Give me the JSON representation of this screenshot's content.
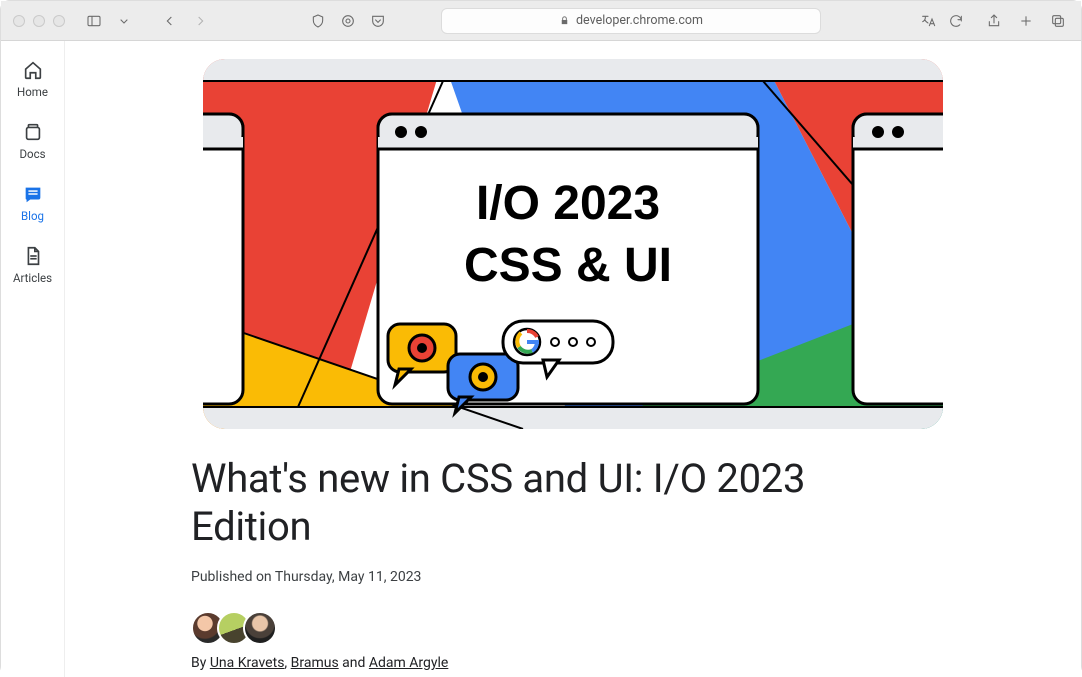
{
  "browser": {
    "url_display": "developer.chrome.com"
  },
  "sidebar": {
    "items": [
      {
        "label": "Home"
      },
      {
        "label": "Docs"
      },
      {
        "label": "Blog"
      },
      {
        "label": "Articles"
      }
    ]
  },
  "hero": {
    "line1": "I/O 2023",
    "line2": "CSS & UI"
  },
  "article": {
    "title": "What's new in CSS and UI: I/O 2023 Edition",
    "published_prefix": "Published on ",
    "published_date": "Thursday, May 11, 2023",
    "by_prefix": "By ",
    "authors": [
      {
        "name": "Una Kravets"
      },
      {
        "name": "Bramus"
      },
      {
        "name": "Adam Argyle"
      }
    ],
    "sep_comma": ", ",
    "sep_and": " and "
  }
}
